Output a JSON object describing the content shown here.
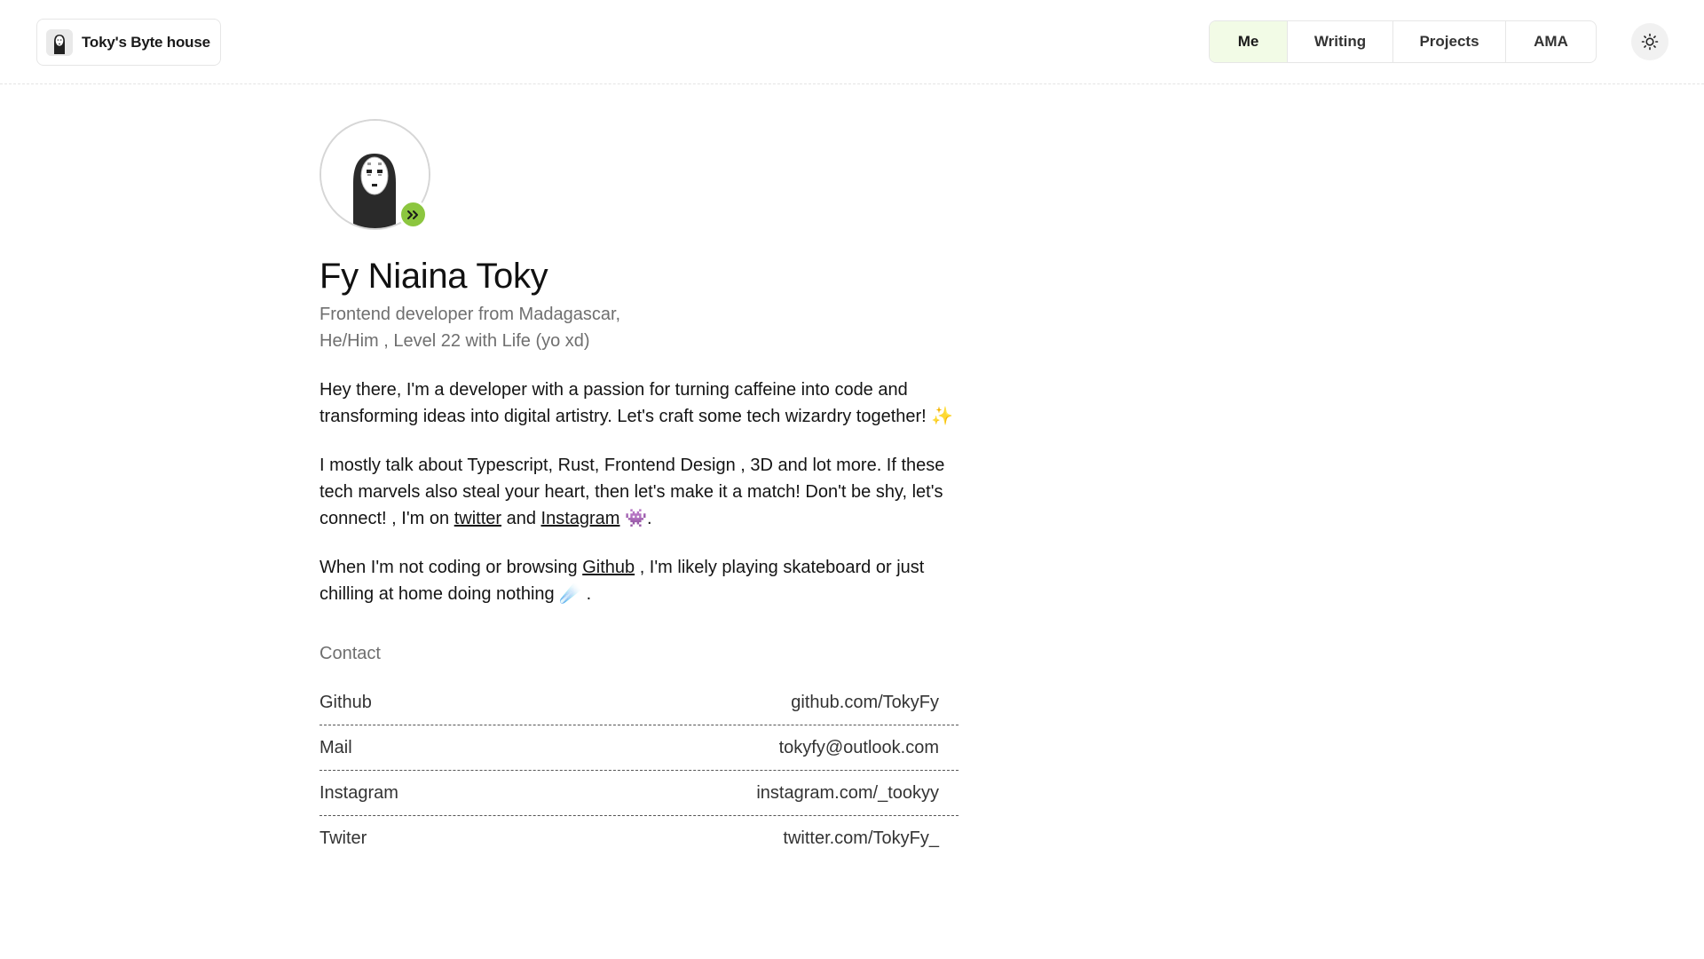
{
  "header": {
    "brand_name": "Toky's Byte house",
    "nav": [
      {
        "label": "Me",
        "active": true
      },
      {
        "label": "Writing",
        "active": false
      },
      {
        "label": "Projects",
        "active": false
      },
      {
        "label": "AMA",
        "active": false
      }
    ],
    "theme_icon": "sun-icon"
  },
  "profile": {
    "name": "Fy Niaina Toky",
    "subtitle_line1": "Frontend developer from Madagascar,",
    "subtitle_line2": "He/Him , Level 22 with Life (yo xd)",
    "status_icon": "fast-forward-icon",
    "status_color": "#8cc63f"
  },
  "about": {
    "p1_text": "Hey there, I'm a developer with a passion for turning caffeine into code and transforming ideas into digital artistry. Let's craft some tech wizardry together!",
    "p1_emoji": "✨",
    "p2_text_before": "I mostly talk about Typescript, Rust, Frontend Design , 3D and lot more. If these tech marvels also steal your heart, then let's make it a match! Don't be shy, let's connect! , I'm on",
    "p2_link1": "twitter",
    "p2_and": "and",
    "p2_link2": "Instagram",
    "p2_emoji": "👾",
    "p2_end": ".",
    "p3_text_before": "When I'm not coding or browsing",
    "p3_link": "Github",
    "p3_text_after": ", I'm likely playing skateboard or just chilling at home doing nothing",
    "p3_emoji": "☄️",
    "p3_end": "."
  },
  "contact": {
    "heading": "Contact",
    "rows": [
      {
        "label": "Github",
        "value": "github.com/TokyFy"
      },
      {
        "label": "Mail",
        "value": "tokyfy@outlook.com"
      },
      {
        "label": "Instagram",
        "value": "instagram.com/_tookyy"
      },
      {
        "label": "Twiter",
        "value": "twitter.com/TokyFy_"
      }
    ]
  }
}
